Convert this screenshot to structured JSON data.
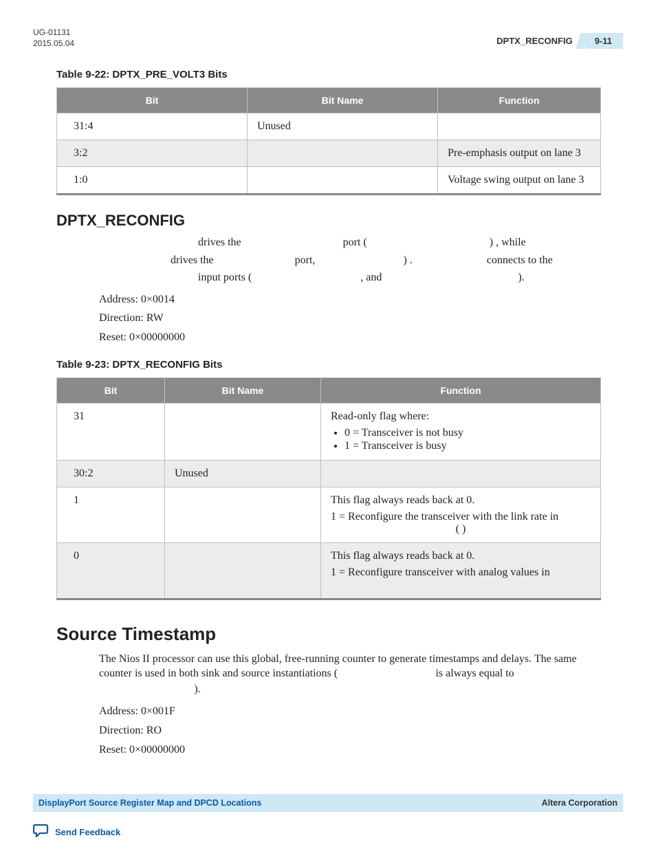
{
  "header": {
    "doc_id": "UG-01131",
    "date": "2015.05.04",
    "section": "DPTX_RECONFIG",
    "page": "9-11"
  },
  "table22": {
    "title": "Table 9-22: DPTX_PRE_VOLT3 Bits",
    "headers": [
      "Bit",
      "Bit Name",
      "Function"
    ],
    "rows": [
      {
        "bit": "31:4",
        "name": "Unused",
        "func": ""
      },
      {
        "bit": "3:2",
        "name": "",
        "func": "Pre-emphasis output on lane 3"
      },
      {
        "bit": "1:0",
        "name": "",
        "func": "Voltage swing output on lane 3"
      }
    ]
  },
  "dptx_reconfig": {
    "heading": "DPTX_RECONFIG",
    "para_drives_the1": " drives the ",
    "para_port_paren": " port ( ",
    "para_close_while": " ) , while ",
    "para_drives_the2": " drives the ",
    "para_port_comma": " port, ",
    "para_close_dot": " ) . ",
    "para_connects": " connects to the",
    "para_input_ports": " input ports ( ",
    "para_and": " , and ",
    "para_final_close": " ).",
    "address": "Address: 0×0014",
    "direction": "Direction: RW",
    "reset": "Reset: 0×00000000"
  },
  "table23": {
    "title": "Table 9-23: DPTX_RECONFIG Bits",
    "headers": [
      "Bit",
      "Bit Name",
      "Function"
    ],
    "rows": [
      {
        "bit": "31",
        "name": "",
        "func_intro": "Read-only flag where:",
        "func_items": [
          "0 = Transceiver is not busy",
          "1 = Transceiver is busy"
        ]
      },
      {
        "bit": "30:2",
        "name": "Unused",
        "func": ""
      },
      {
        "bit": "1",
        "name": "",
        "func_l1": "This flag always reads back at 0.",
        "func_l2": "1 = Reconfigure the transceiver with the link rate in",
        "func_tail": "(                      )"
      },
      {
        "bit": "0",
        "name": "",
        "func_l1": "This flag always reads back at 0.",
        "func_l2": "1 = Reconfigure transceiver with analog values in"
      }
    ]
  },
  "source_timestamp": {
    "heading": "Source Timestamp",
    "para": "The Nios II processor can use this global, free-running counter to generate timestamps and delays. The same counter is used in both sink and source instantiations (",
    "para_mid": " is always equal to ",
    "para_end": ").",
    "address": "Address: 0×001F",
    "direction": "Direction: RO",
    "reset": "Reset: 0×00000000"
  },
  "footer": {
    "left": "DisplayPort Source Register Map and DPCD Locations",
    "right": "Altera Corporation",
    "feedback": "Send Feedback"
  }
}
